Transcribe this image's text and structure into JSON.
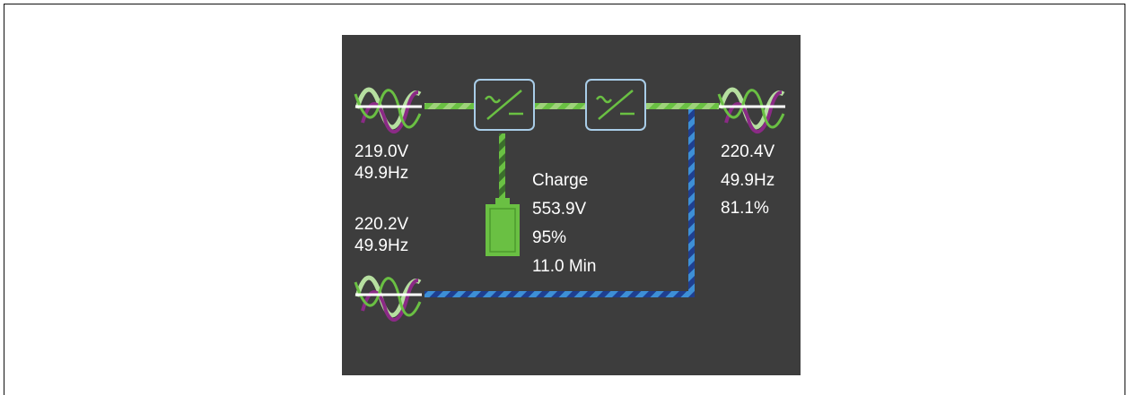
{
  "colors": {
    "panel_background": "#3d3d3d",
    "ac_line_stripe_a": "#6ac043",
    "ac_line_stripe_b": "#9ed27a",
    "bypass_line_stripe_a": "#1f3f8f",
    "bypass_line_stripe_b": "#3d8fd6",
    "dc_line_stripe_a": "#6ac043",
    "dc_line_stripe_b": "#3b6e2c",
    "battery_fill": "#6ac043",
    "converter_border": "#a9cde8",
    "converter_symbol": "#6ac043",
    "wave_magenta": "#8b2a86",
    "wave_light_green": "#b6dfa0",
    "wave_green": "#6ac043"
  },
  "icons": {
    "mains_input": "ac-sine-wave-icon",
    "bypass_input": "ac-sine-wave-icon",
    "output": "ac-sine-wave-icon",
    "rectifier": "ac-dc-converter-icon",
    "inverter": "ac-dc-converter-icon",
    "battery": "battery-icon"
  },
  "mains_input": {
    "voltage": "219.0V",
    "frequency": "49.9Hz"
  },
  "bypass_input": {
    "voltage": "220.2V",
    "frequency": "49.9Hz"
  },
  "output": {
    "voltage": "220.4V",
    "frequency": "49.9Hz",
    "load": "81.1%"
  },
  "battery": {
    "state": "Charge",
    "voltage": "553.9V",
    "capacity": "95%",
    "runtime": "11.0 Min",
    "level": 0.95
  }
}
